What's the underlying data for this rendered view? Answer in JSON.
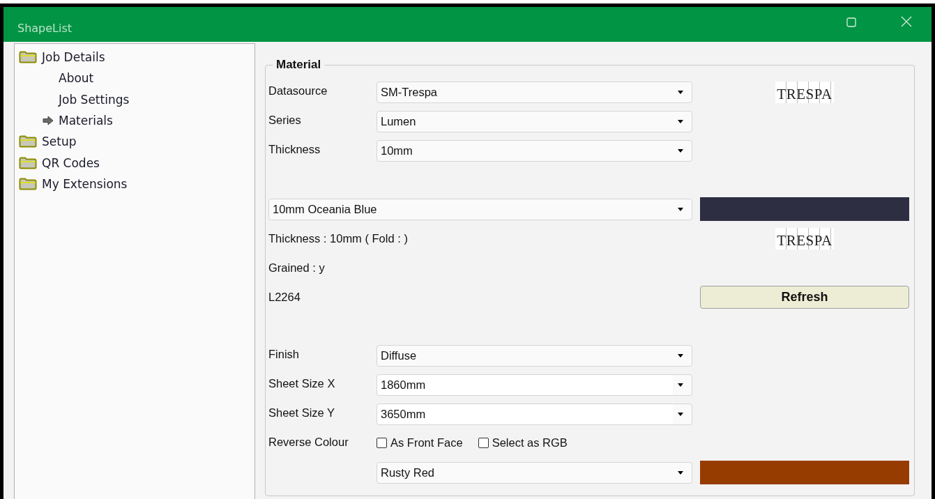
{
  "window": {
    "title": "ShapeList"
  },
  "tree": [
    {
      "label": "Job Details",
      "selected": false,
      "children": [
        {
          "label": "About",
          "selected": false
        },
        {
          "label": "Job Settings",
          "selected": false
        },
        {
          "label": "Materials",
          "selected": true
        }
      ]
    },
    {
      "label": "Setup",
      "selected": false
    },
    {
      "label": "QR Codes",
      "selected": false
    },
    {
      "label": "My Extensions",
      "selected": false
    }
  ],
  "material": {
    "legend": "Material",
    "datasource": {
      "label": "Datasource",
      "value": "SM-Trespa"
    },
    "series": {
      "label": "Series",
      "value": "Lumen"
    },
    "thickness": {
      "label": "Thickness",
      "value": "10mm"
    },
    "logo": "TRESPA",
    "product": {
      "value": "10mm Oceania Blue",
      "color": "#2e2e42"
    },
    "thickness_info": "Thickness : 10mm ( Fold :  )",
    "logo_2": "TRESPA",
    "grained": "Grained : y",
    "code": "L2264",
    "refresh_button": "Refresh",
    "finish": {
      "label": "Finish",
      "value": "Diffuse"
    },
    "sheet_size_x": {
      "label": "Sheet Size X",
      "value": "1860mm"
    },
    "sheet_size_y": {
      "label": "Sheet Size Y",
      "value": "3650mm"
    },
    "reverse_colour": {
      "label": "Reverse Colour",
      "options": [
        {
          "label": "As Front Face",
          "checked": false
        },
        {
          "label": "Select as RGB",
          "checked": false
        }
      ],
      "value": "Rusty Red",
      "color": "#963c00"
    }
  }
}
